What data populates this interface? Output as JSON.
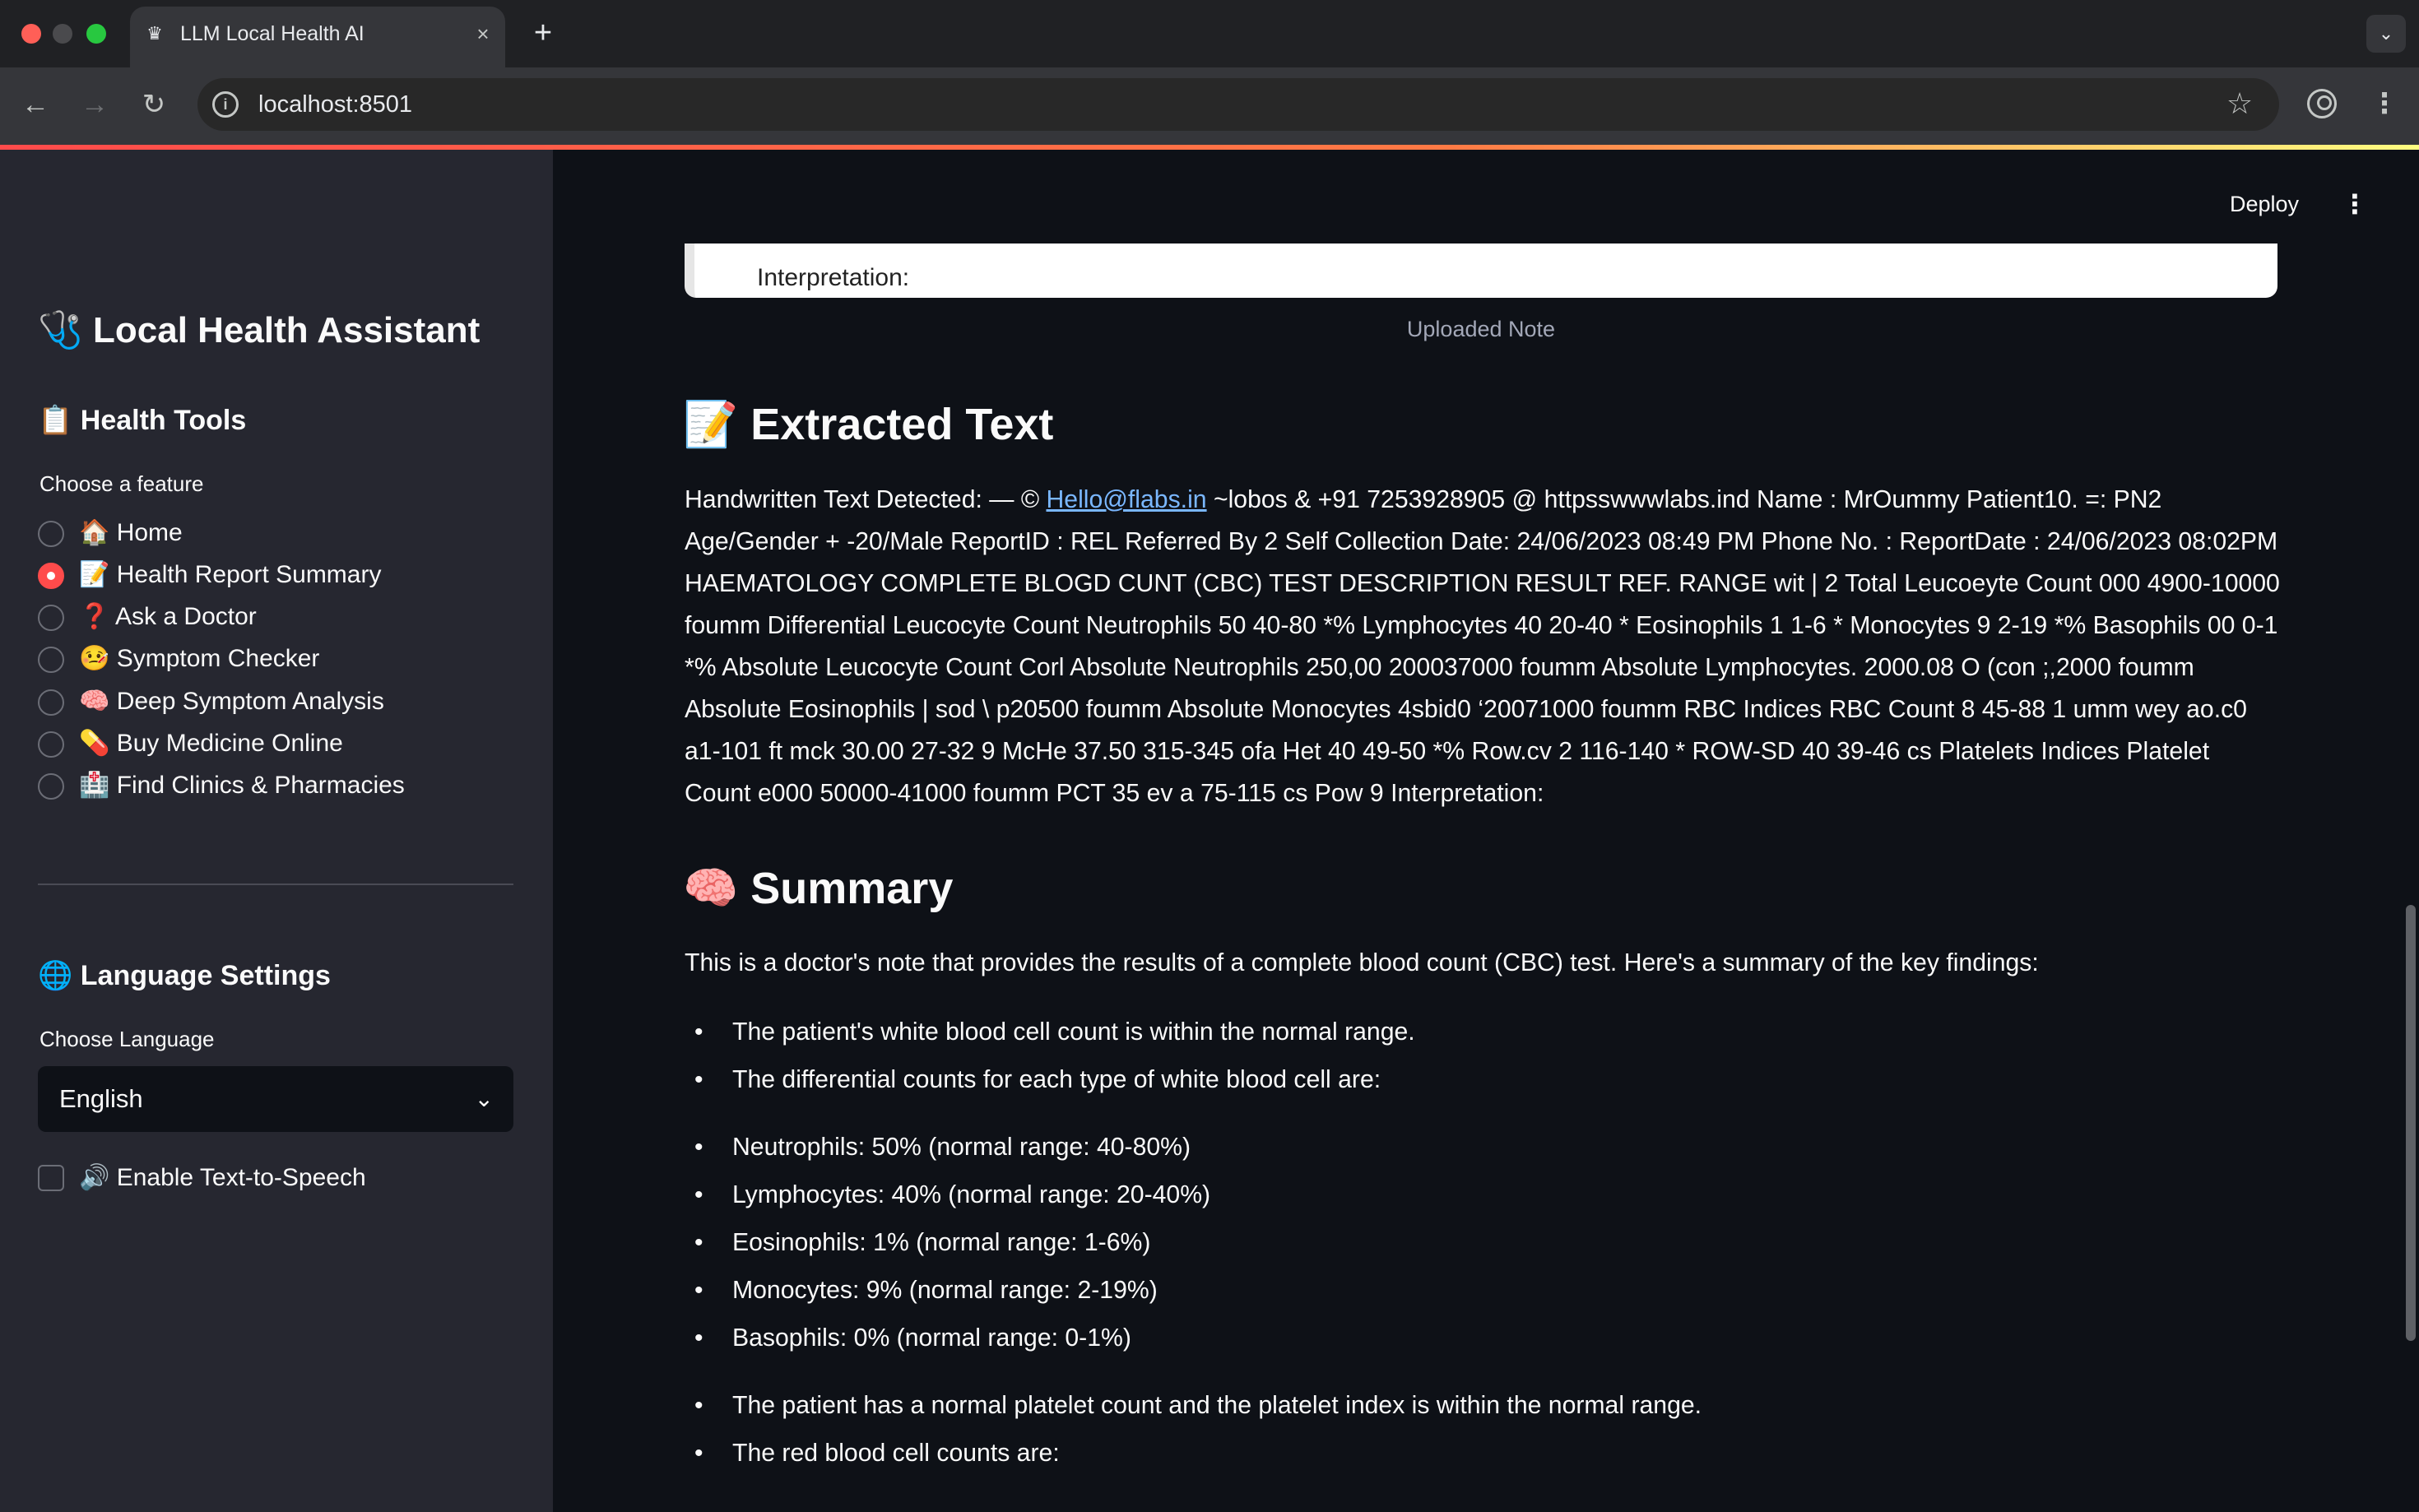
{
  "browser": {
    "tab_title": "LLM Local Health AI",
    "url": "localhost:8501",
    "tab_favicon": "crown-icon"
  },
  "sidebar": {
    "title": "🩺 Local Health Assistant",
    "tools_heading": "📋 Health Tools",
    "feature_label": "Choose a feature",
    "features": [
      {
        "label": "🏠 Home",
        "selected": false
      },
      {
        "label": "📝 Health Report Summary",
        "selected": true
      },
      {
        "label": "❓ Ask a Doctor",
        "selected": false
      },
      {
        "label": "🤒 Symptom Checker",
        "selected": false
      },
      {
        "label": "🧠 Deep Symptom Analysis",
        "selected": false
      },
      {
        "label": "💊 Buy Medicine Online",
        "selected": false
      },
      {
        "label": "🏥 Find Clinics & Pharmacies",
        "selected": false
      }
    ],
    "language_heading": "🌐 Language Settings",
    "language_label": "Choose Language",
    "language_value": "English",
    "tts_label": "🔊 Enable Text-to-Speech",
    "tts_checked": false
  },
  "main": {
    "deploy_label": "Deploy",
    "image_visible_text": "Interpretation:",
    "image_caption": "Uploaded Note",
    "extracted_heading": "📝 Extracted Text",
    "extracted_prefix": "Handwritten Text Detected: — © ",
    "extracted_link": "Hello@flabs.in",
    "extracted_rest": " ~lobos & +91 7253928905 @ httpsswwwlabs.ind Name : MrOummy Patient10. =: PN2 Age/Gender + -20/Male ReportID : REL Referred By 2 Self Collection Date: 24/06/2023 08:49 PM Phone No. : ReportDate : 24/06/2023 08:02PM HAEMATOLOGY COMPLETE BLOGD CUNT (CBC) TEST DESCRIPTION RESULT REF. RANGE wit | 2 Total Leucoeyte Count 000 4900-10000 foumm Differential Leucocyte Count Neutrophils 50 40-80 *% Lymphocytes 40 20-40 * Eosinophils 1 1-6 * Monocytes 9 2-19 *% Basophils 00 0-1 *% Absolute Leucocyte Count Corl Absolute Neutrophils 250,00 200037000 foumm Absolute Lymphocytes. 2000.08 O (con ;,2000 foumm Absolute Eosinophils | sod \\ p20500 foumm Absolute Monocytes 4sbid0 ‘20071000 foumm RBC Indices RBC Count 8 45-88 1 umm wey ao.c0 a1-101 ft mck 30.00 27-32 9 McHe 37.50 315-345 ofa Het 40 49-50 *% Row.cv 2 116-140 * ROW-SD 40 39-46 cs Platelets Indices Platelet Count e000 50000-41000 foumm PCT 35 ev a 75-115 cs Pow 9 Interpretation:",
    "summary_heading": "🧠 Summary",
    "summary_intro": "This is a doctor's note that provides the results of a complete blood count (CBC) test. Here's a summary of the key findings:",
    "summary_bullets_1": [
      "The patient's white blood cell count is within the normal range.",
      "The differential counts for each type of white blood cell are:"
    ],
    "summary_bullets_2": [
      "Neutrophils: 50% (normal range: 40-80%)",
      "Lymphocytes: 40% (normal range: 20-40%)",
      "Eosinophils: 1% (normal range: 1-6%)",
      "Monocytes: 9% (normal range: 2-19%)",
      "Basophils: 0% (normal range: 0-1%)"
    ],
    "summary_bullets_3": [
      "The patient has a normal platelet count and the platelet index is within the normal range.",
      "The red blood cell counts are:"
    ]
  },
  "colors": {
    "accent": "#ff4b4b",
    "sidebar_bg": "#262730",
    "main_bg": "#0e1117",
    "link": "#7ab7ff"
  }
}
